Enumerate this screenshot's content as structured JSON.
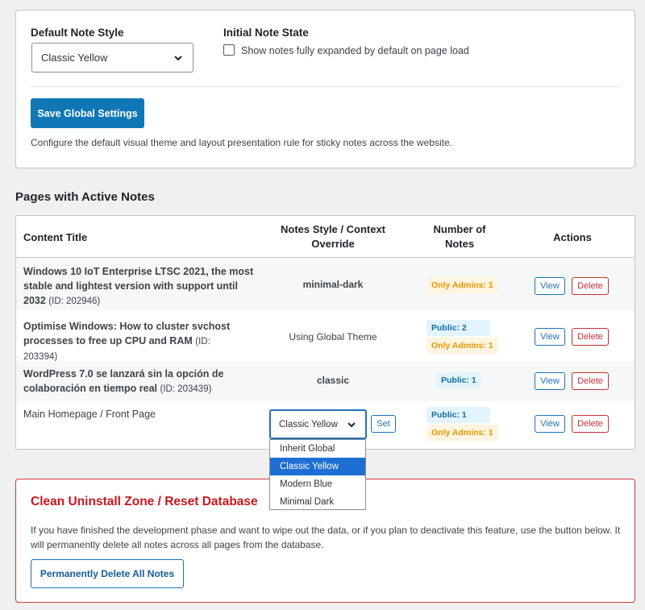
{
  "settings": {
    "style_label": "Default Note Style",
    "style_value": "Classic Yellow",
    "state_label": "Initial Note State",
    "state_checkbox_label": "Show notes fully expanded by default on page load",
    "save_label": "Save Global Settings",
    "description": "Configure the default visual theme and layout presentation rule for sticky notes across the website."
  },
  "pages": {
    "heading": "Pages with Active Notes",
    "columns": [
      "Content Title",
      "Notes Style / Context Override",
      "Number of Notes",
      "Actions"
    ],
    "rows": [
      {
        "title": "Windows 10 IoT Enterprise LTSC 2021, the most stable and lightest version with support until 2032",
        "id": "(ID: 202946)",
        "style": "minimal-dark",
        "badges": [
          "Only Admins: 1"
        ]
      },
      {
        "title": "Optimise Windows: How to cluster svchost processes to free up CPU and RAM",
        "id": "(ID: 203394)",
        "style": "Using Global Theme",
        "badges": [
          "Public: 2",
          "Only Admins: 1"
        ]
      },
      {
        "title": "WordPress 7.0 se lanzará sin la opción de colaboración en tiempo real",
        "id": "(ID: 203439)",
        "style": "classic",
        "badges": [
          "Public: 1"
        ]
      },
      {
        "title": "Main Homepage / Front Page",
        "style_select_value": "Classic Yellow",
        "set_label": "Set",
        "badges": [
          "Public: 1",
          "Only Admins: 1"
        ]
      }
    ],
    "view_label": "View",
    "delete_label": "Delete",
    "dropdown_options": [
      "Inherit Global",
      "Classic Yellow",
      "Modern Blue",
      "Minimal Dark"
    ],
    "dropdown_selected": "Classic Yellow"
  },
  "danger": {
    "title": "Clean Uninstall Zone / Reset Database",
    "text": "If you have finished the development phase and want to wipe out the data, or if you plan to deactivate this feature, use the button below. It will permanently delete all notes across all pages from the database.",
    "button_label": "Permanently Delete All Notes"
  },
  "colors": {
    "primary": "#0f77b6",
    "danger": "#d63638",
    "admin_badge": "#e79800",
    "public_badge": "#0e6fa6"
  }
}
